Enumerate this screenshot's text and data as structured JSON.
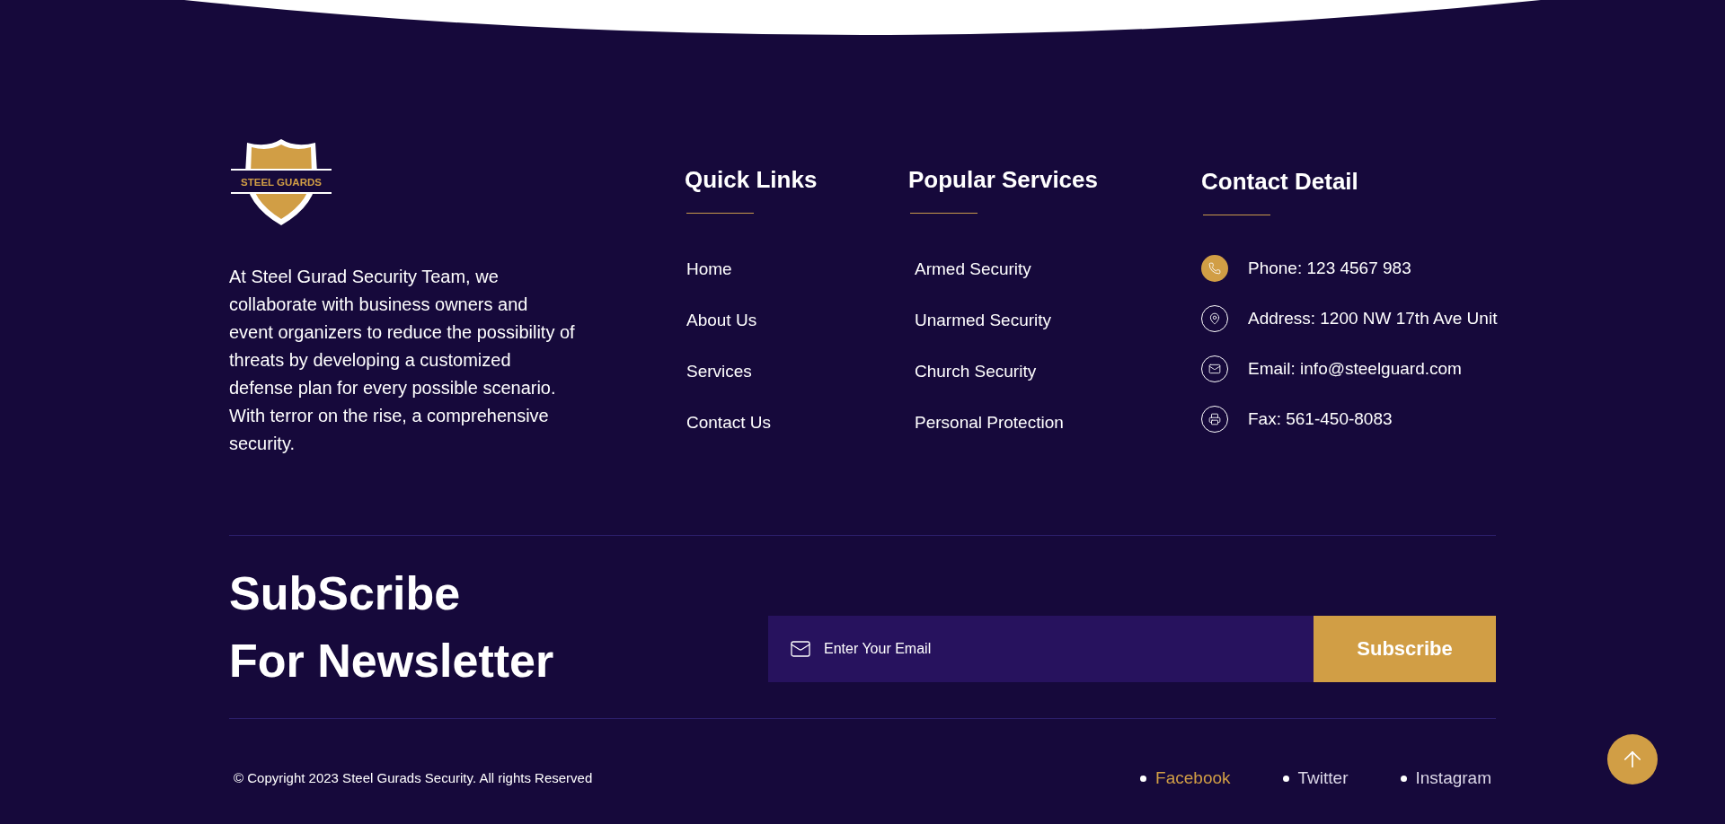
{
  "brand": {
    "logo_text": "STEEL GUARDS",
    "about": "At Steel Gurad Security Team, we collaborate with business owners and event organizers to reduce the possibility of threats by developing a customized defense plan for every possible scenario. With terror on the rise, a comprehensive security."
  },
  "quick_links": {
    "title": "Quick Links",
    "items": [
      "Home",
      "About Us",
      "Services",
      "Contact Us"
    ]
  },
  "popular_services": {
    "title": "Popular Services",
    "items": [
      "Armed Security",
      "Unarmed Security",
      "Church Security",
      "Personal Protection"
    ]
  },
  "contact": {
    "title": "Contact Detail",
    "items": [
      {
        "kind": "phone",
        "text": "Phone: 123 4567 983",
        "highlighted": true
      },
      {
        "kind": "address",
        "text": "Address: 1200 NW 17th Ave Unit",
        "highlighted": false
      },
      {
        "kind": "email",
        "text": "Email: info@steelguard.com",
        "highlighted": false
      },
      {
        "kind": "fax",
        "text": "Fax: 561-450-8083",
        "highlighted": false
      }
    ]
  },
  "newsletter": {
    "title_lines": [
      "SubScribe",
      "For Newsletter"
    ],
    "placeholder": "Enter Your Email",
    "button": "Subscribe"
  },
  "copyright": "© Copyright 2023 Steel Gurads Security. All rights Reserved",
  "social": [
    {
      "label": "Facebook",
      "selected": true
    },
    {
      "label": "Twitter",
      "selected": false
    },
    {
      "label": "Instagram",
      "selected": false
    }
  ]
}
